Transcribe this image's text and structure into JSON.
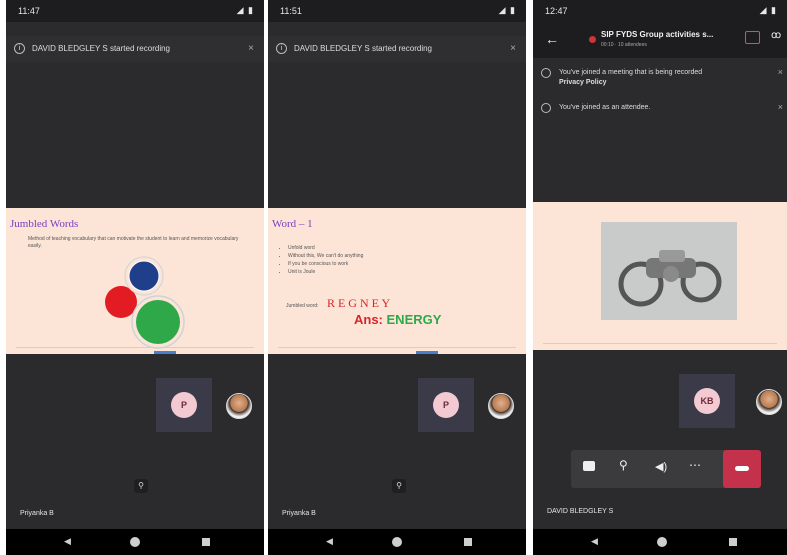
{
  "phones": [
    {
      "status_time": "11:47",
      "banner": "DAVID BLEDGLEY S started recording",
      "slide": {
        "title": "Jumbled Words",
        "text": "Method of teaching vocabulary that can motivate the student to learn and memorize vocabulary easily."
      },
      "avatar_initial": "P",
      "user_name": "Priyanka B"
    },
    {
      "status_time": "11:51",
      "banner": "DAVID BLEDGLEY S started recording",
      "slide": {
        "title": "Word – 1",
        "bullets": [
          "Unfold word",
          "Without this, We can't do anything",
          "If you be conscious to work",
          "Unit is Joule"
        ],
        "jumbled_label": "Jumbled word:",
        "jumbled_word": "R E G N E Y",
        "ans_label": "Ans:",
        "ans_word": "ENERGY"
      },
      "avatar_initial": "P",
      "user_name": "Priyanka B"
    },
    {
      "status_time": "12:47",
      "meeting_title": "SIP FYDS Group activities s...",
      "meeting_sub": "00:10 · 10 attendees",
      "notices": [
        {
          "text": "You've joined a meeting that is being recorded ",
          "bold": "Privacy Policy"
        },
        {
          "text": "You've joined as an attendee.",
          "bold": ""
        }
      ],
      "avatar_initial": "KB",
      "user_name": "DAVID BLEDGLEY S"
    }
  ],
  "colors": {
    "phone_bg": "#2b2b2d",
    "slide_bg": "#fce4d6",
    "accent_purple": "#7b3fc0",
    "jumbled_red": "#d9252a",
    "answer_green": "#2fa84a",
    "hangup": "#c4314b"
  },
  "icons": {
    "back": "back-arrow-icon",
    "rec": "recording-icon",
    "chat": "chat-icon",
    "people": "participants-icon",
    "camera": "camera-icon",
    "mic": "mic-icon",
    "speaker": "speaker-icon",
    "more": "more-icon",
    "hangup": "hangup-icon"
  }
}
